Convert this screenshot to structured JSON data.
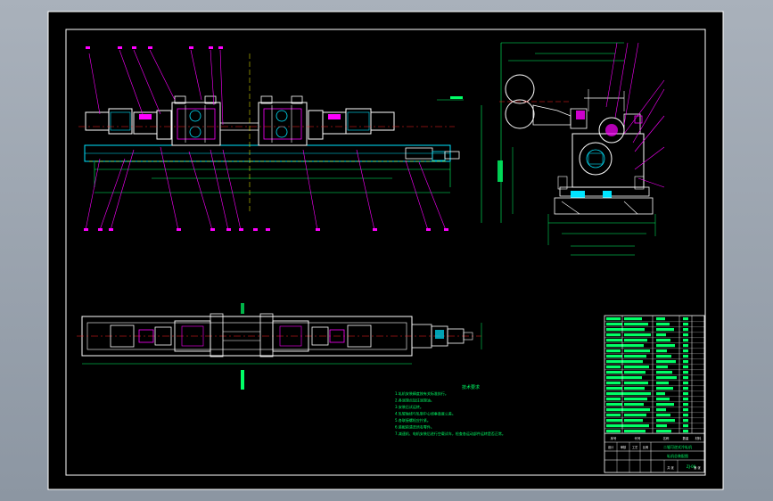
{
  "window": {
    "background_top": "#a9b1bb",
    "background_bottom": "#8c96a2"
  },
  "drawing": {
    "sheet_color": "#000000",
    "frame_color": "#ffffff",
    "accent_green": "#00ff66",
    "accent_magenta": "#ff00ff",
    "accent_cyan": "#00e5ff",
    "accent_yellow": "#ffff00",
    "accent_red": "#ff2020"
  },
  "notes": {
    "heading": "技术要求",
    "lines": [
      "1.轧机安装精度按有关标准执行。",
      "2.各润滑点加注润滑油。",
      "3.安装后试运转。",
      "4.轧辊轴线与轧制中心线垂直度公差。",
      "5.各联接螺栓应拧紧。",
      "6.装配前清洗所有零件。",
      "7.减速机、电机安装后进行空载试车，检查各运动部件运转是否正常。"
    ]
  },
  "title_block": {
    "title_line1": "二辊可逆式冷轧机",
    "title_line2": "轧机总装配图",
    "drawing_no": "ZJ-00",
    "header_cells": [
      "序号",
      "代号",
      "名称",
      "数量",
      "材料",
      "备注"
    ],
    "bottom_cells": [
      "设计",
      "审核",
      "工艺",
      "比例",
      "共 张",
      "第 张"
    ]
  }
}
